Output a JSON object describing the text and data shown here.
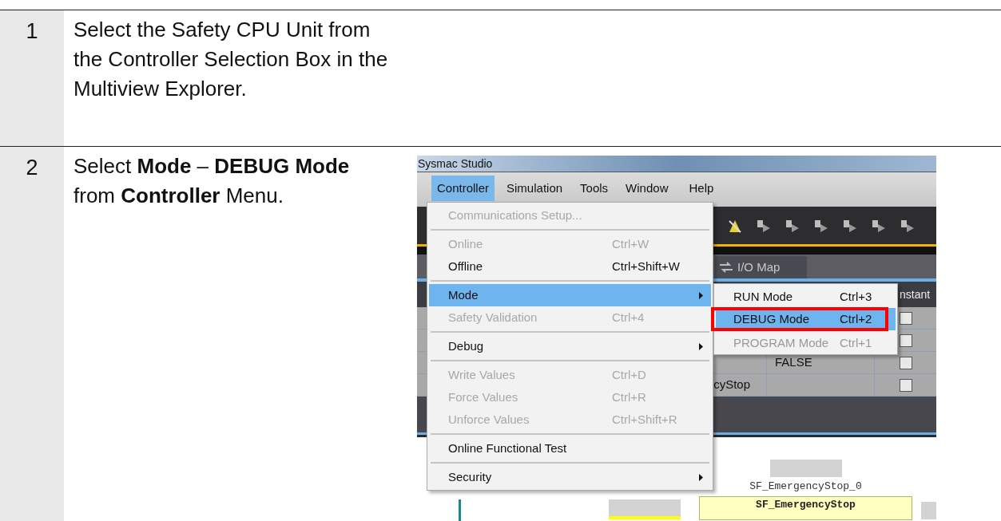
{
  "steps": [
    {
      "number": "1",
      "text": "Select the Safety CPU Unit from the Controller Selection Box in the Multiview Explorer."
    },
    {
      "number": "2",
      "text": "Select **Mode** – **DEBUG Mode** from **Controller** Menu.",
      "screenshot": {
        "title": "Sysmac Studio",
        "menubar": [
          {
            "label": "Controller",
            "selected": true
          },
          {
            "label": "Simulation",
            "selected": false
          },
          {
            "label": "Tools",
            "selected": false
          },
          {
            "label": "Window",
            "selected": false
          },
          {
            "label": "Help",
            "selected": false
          }
        ],
        "tab": "I/O Map",
        "grid_header": "nstant",
        "grid_rows": [
          {
            "checked": false
          },
          {
            "checked": false
          },
          {
            "column_2": "FALSE",
            "checked": false
          },
          {
            "column_1": "cyStop",
            "checked": false
          }
        ],
        "diagram": {
          "instance": "SF_EmergencyStop_0",
          "block": "SF_EmergencyStop"
        },
        "menu": [
          {
            "kind": "item",
            "label": "Communications Setup...",
            "disabled": true,
            "selected": false
          },
          {
            "kind": "separator"
          },
          {
            "kind": "item",
            "label": "Online",
            "shortcut": "Ctrl+W",
            "disabled": true,
            "selected": false
          },
          {
            "kind": "item",
            "label": "Offline",
            "shortcut": "Ctrl+Shift+W",
            "disabled": false,
            "selected": false
          },
          {
            "kind": "separator"
          },
          {
            "kind": "item",
            "label": "Mode",
            "submenu": true,
            "disabled": false,
            "selected": true
          },
          {
            "kind": "item",
            "label": "Safety Validation",
            "shortcut": "Ctrl+4",
            "disabled": true,
            "selected": false
          },
          {
            "kind": "separator"
          },
          {
            "kind": "item",
            "label": "Debug",
            "submenu": true,
            "disabled": false,
            "selected": false
          },
          {
            "kind": "separator"
          },
          {
            "kind": "item",
            "label": "Write Values",
            "shortcut": "Ctrl+D",
            "disabled": true,
            "selected": false
          },
          {
            "kind": "item",
            "label": "Force Values",
            "shortcut": "Ctrl+R",
            "disabled": true,
            "selected": false
          },
          {
            "kind": "item",
            "label": "Unforce Values",
            "shortcut": "Ctrl+Shift+R",
            "disabled": true,
            "selected": false
          },
          {
            "kind": "separator"
          },
          {
            "kind": "item",
            "label": "Online Functional Test",
            "disabled": false,
            "selected": false
          },
          {
            "kind": "separator"
          },
          {
            "kind": "item",
            "label": "Security",
            "submenu": true,
            "disabled": false,
            "selected": false
          }
        ],
        "submenu": [
          {
            "label": "RUN Mode",
            "shortcut": "Ctrl+3",
            "disabled": false,
            "selected": false,
            "highlighted": false
          },
          {
            "label": "DEBUG Mode",
            "shortcut": "Ctrl+2",
            "disabled": false,
            "selected": true,
            "highlighted": true
          },
          {
            "label": "PROGRAM Mode",
            "shortcut": "Ctrl+1",
            "disabled": true,
            "selected": false,
            "highlighted": false
          }
        ]
      }
    }
  ]
}
